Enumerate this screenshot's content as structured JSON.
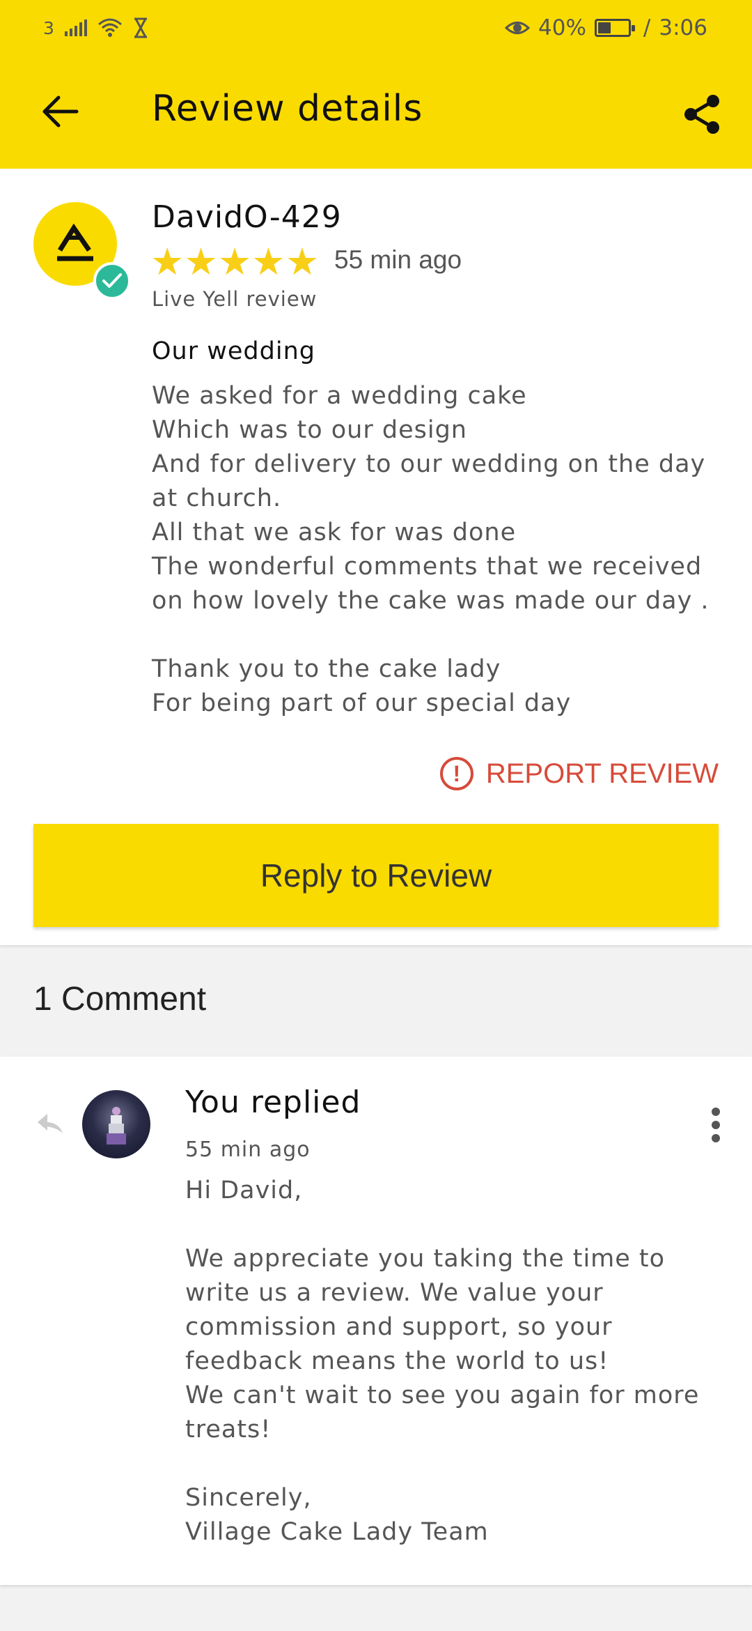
{
  "status_bar": {
    "carrier": "3",
    "battery_percent": "40%",
    "time": "3:06",
    "battery_level": 0.4
  },
  "header": {
    "title": "Review details",
    "back_icon": "arrow-left-icon",
    "share_icon": "share-icon"
  },
  "review": {
    "author": "DavidO-429",
    "rating": 5,
    "stars": [
      "★",
      "★",
      "★",
      "★",
      "★"
    ],
    "time_ago": "55 min ago",
    "source": "Live Yell review",
    "title": "Our wedding",
    "body": "We asked for a wedding cake\nWhich was to our design\nAnd for delivery to our wedding on the day at church.\nAll that we ask for was done\nThe wonderful comments that we received on how lovely the cake was made our day .\n\nThank you to the cake lady\nFor being part of our special day",
    "report_label": "REPORT REVIEW",
    "report_icon_glyph": "!",
    "reply_label": "Reply to Review"
  },
  "comments": {
    "header": "1 Comment",
    "items": [
      {
        "author": "You replied",
        "time_ago": "55 min ago",
        "body": "Hi David,\n\nWe appreciate you taking the time to write us a review. We value your commission and support, so your feedback means the world to us!\nWe can't wait to see you again for more treats!\n\nSincerely,\nVillage Cake Lady Team"
      }
    ]
  },
  "colors": {
    "brand_yellow": "#fadb00",
    "star_yellow": "#f8cf16",
    "report_red": "#d64b3a",
    "verified_green": "#2bb99a"
  }
}
